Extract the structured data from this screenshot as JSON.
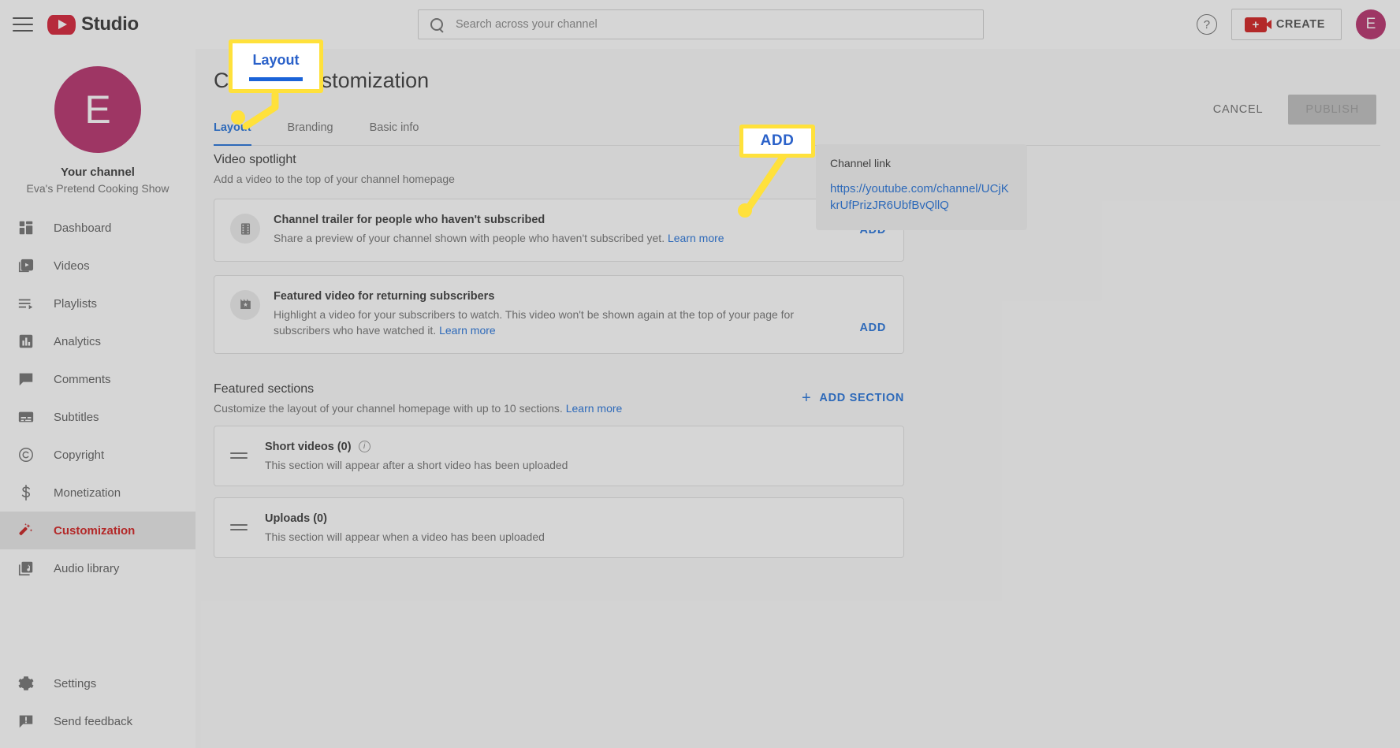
{
  "topbar": {
    "menu_icon": "hamburger-icon",
    "brand": "Studio",
    "search_placeholder": "Search across your channel",
    "search_value": "",
    "help_icon": "help-circle-icon",
    "create_label": "CREATE",
    "avatar_initial": "E"
  },
  "sidebar": {
    "avatar_initial": "E",
    "channel_title": "Your channel",
    "channel_name": "Eva's Pretend Cooking Show",
    "items": [
      {
        "label": "Dashboard",
        "icon": "dashboard-icon",
        "active": false
      },
      {
        "label": "Videos",
        "icon": "video-icon",
        "active": false
      },
      {
        "label": "Playlists",
        "icon": "playlist-icon",
        "active": false
      },
      {
        "label": "Analytics",
        "icon": "analytics-icon",
        "active": false
      },
      {
        "label": "Comments",
        "icon": "comment-icon",
        "active": false
      },
      {
        "label": "Subtitles",
        "icon": "subtitles-icon",
        "active": false
      },
      {
        "label": "Copyright",
        "icon": "copyright-icon",
        "active": false
      },
      {
        "label": "Monetization",
        "icon": "dollar-icon",
        "active": false
      },
      {
        "label": "Customization",
        "icon": "magic-wand-icon",
        "active": true
      },
      {
        "label": "Audio library",
        "icon": "music-library-icon",
        "active": false
      }
    ],
    "bottom_items": [
      {
        "label": "Settings",
        "icon": "gear-icon"
      },
      {
        "label": "Send feedback",
        "icon": "feedback-icon"
      }
    ]
  },
  "main": {
    "page_title": "Channel customization",
    "cancel_label": "CANCEL",
    "publish_label": "PUBLISH",
    "tabs": [
      {
        "label": "Layout",
        "selected": true
      },
      {
        "label": "Branding",
        "selected": false
      },
      {
        "label": "Basic info",
        "selected": false
      }
    ],
    "video_spotlight": {
      "heading": "Video spotlight",
      "subheading": "Add a video to the top of your channel homepage",
      "cards": [
        {
          "icon": "film-strip-icon",
          "title": "Channel trailer for people who haven't subscribed",
          "desc": "Share a preview of your channel shown with people who haven't subscribed yet.",
          "learn_more": "Learn more",
          "add_label": "ADD"
        },
        {
          "icon": "featured-video-icon",
          "title": "Featured video for returning subscribers",
          "desc": "Highlight a video for your subscribers to watch. This video won't be shown again at the top of your page for subscribers who have watched it.",
          "learn_more": "Learn more",
          "add_label": "ADD"
        }
      ]
    },
    "featured_sections": {
      "heading": "Featured sections",
      "subheading": "Customize the layout of your channel homepage with up to 10 sections.",
      "learn_more": "Learn more",
      "add_section_label": "ADD SECTION",
      "rows": [
        {
          "drag_handle": "drag-handle-icon",
          "title": "Short videos (0)",
          "info_icon": "info-icon",
          "desc": "This section will appear after a short video has been uploaded"
        },
        {
          "drag_handle": "drag-handle-icon",
          "title": "Uploads (0)",
          "desc": "This section will appear when a video has been uploaded"
        }
      ]
    },
    "channel_link_panel": {
      "label": "Channel link",
      "url": "https://youtube.com/channel/UCjKkrUfPrizJR6UbfBvQllQ"
    }
  },
  "callouts": [
    {
      "id": "layout",
      "text": "Layout"
    },
    {
      "id": "add",
      "text": "ADD"
    }
  ],
  "colors": {
    "accent_blue": "#065fd4",
    "brand_red": "#c00000",
    "highlight_yellow": "#ffe13b",
    "avatar_magenta": "#ad1457"
  }
}
